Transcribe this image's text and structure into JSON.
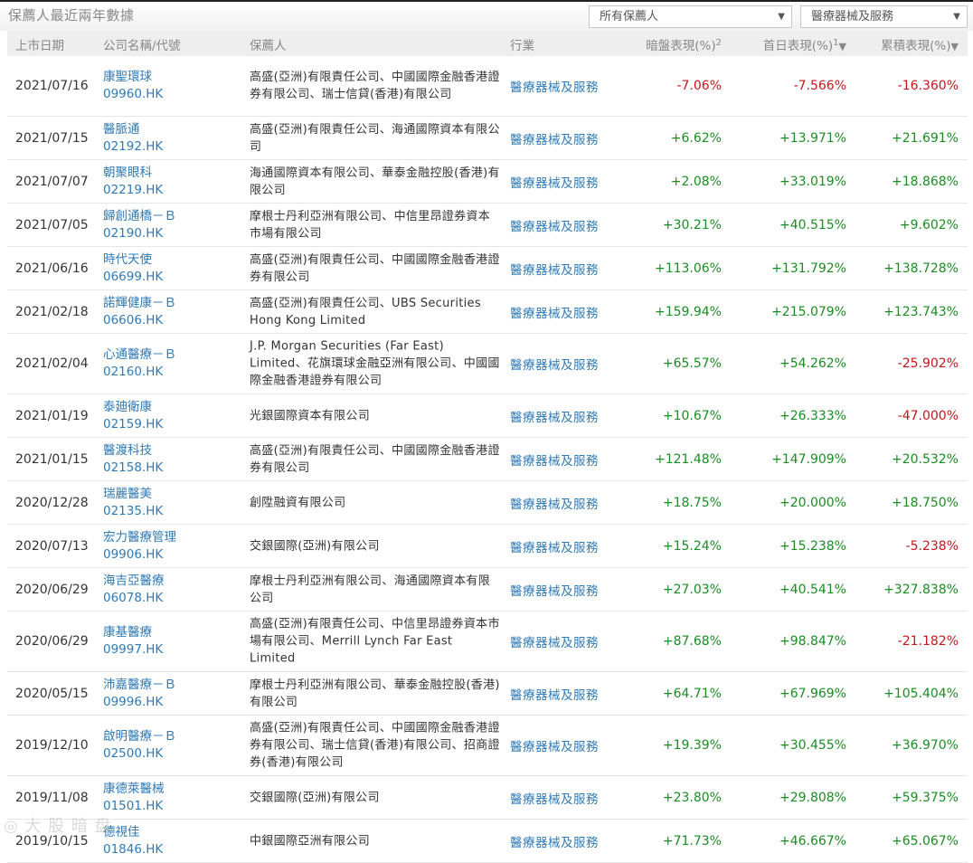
{
  "header": {
    "title": "保薦人最近兩年數據",
    "sponsor_filter": "所有保薦人",
    "industry_filter": "醫療器械及服務"
  },
  "columns": {
    "date": "上市日期",
    "company": "公司名稱/代號",
    "sponsor": "保薦人",
    "industry": "行業",
    "grey": "暗盤表現(%)",
    "grey_sup": "2",
    "first": "首日表現(%)",
    "first_sup": "1",
    "first_sort": "▼",
    "cum": "累積表現(%)",
    "cum_sort": "▼"
  },
  "rows": [
    {
      "date": "2021/07/16",
      "name": "康聖環球",
      "code": "09960.HK",
      "sponsor": "高盛(亞洲)有限責任公司、中國國際金融香港證券有限公司、瑞士信貸(香港)有限公司",
      "industry": "醫療器械及服務",
      "grey": "-7.06%",
      "first": "-7.566%",
      "cum": "-16.360%"
    },
    {
      "date": "2021/07/15",
      "name": "醫脈通",
      "code": "02192.HK",
      "sponsor": "高盛(亞洲)有限責任公司、海通國際資本有限公司",
      "industry": "醫療器械及服務",
      "grey": "+6.62%",
      "first": "+13.971%",
      "cum": "+21.691%"
    },
    {
      "date": "2021/07/07",
      "name": "朝聚眼科",
      "code": "02219.HK",
      "sponsor": "海通國際資本有限公司、華泰金融控股(香港)有限公司",
      "industry": "醫療器械及服務",
      "grey": "+2.08%",
      "first": "+33.019%",
      "cum": "+18.868%"
    },
    {
      "date": "2021/07/05",
      "name": "歸創通橋－Ｂ",
      "code": "02190.HK",
      "sponsor": "摩根士丹利亞洲有限公司、中信里昂證券資本市場有限公司",
      "industry": "醫療器械及服務",
      "grey": "+30.21%",
      "first": "+40.515%",
      "cum": "+9.602%"
    },
    {
      "date": "2021/06/16",
      "name": "時代天使",
      "code": "06699.HK",
      "sponsor": "高盛(亞洲)有限責任公司、中國國際金融香港證券有限公司",
      "industry": "醫療器械及服務",
      "grey": "+113.06%",
      "first": "+131.792%",
      "cum": "+138.728%"
    },
    {
      "date": "2021/02/18",
      "name": "諾輝健康－Ｂ",
      "code": "06606.HK",
      "sponsor": "高盛(亞洲)有限責任公司、UBS Securities Hong Kong Limited",
      "industry": "醫療器械及服務",
      "grey": "+159.94%",
      "first": "+215.079%",
      "cum": "+123.743%"
    },
    {
      "date": "2021/02/04",
      "name": "心通醫療－Ｂ",
      "code": "02160.HK",
      "sponsor": "J.P. Morgan Securities (Far East) Limited、花旗環球金融亞洲有限公司、中國國際金融香港證券有限公司",
      "industry": "醫療器械及服務",
      "grey": "+65.57%",
      "first": "+54.262%",
      "cum": "-25.902%"
    },
    {
      "date": "2021/01/19",
      "name": "泰廸衛康",
      "code": "02159.HK",
      "sponsor": "光銀國際資本有限公司",
      "industry": "醫療器械及服務",
      "grey": "+10.67%",
      "first": "+26.333%",
      "cum": "-47.000%"
    },
    {
      "date": "2021/01/15",
      "name": "醫渡科技",
      "code": "02158.HK",
      "sponsor": "高盛(亞洲)有限責任公司、中國國際金融香港證券有限公司",
      "industry": "醫療器械及服務",
      "grey": "+121.48%",
      "first": "+147.909%",
      "cum": "+20.532%"
    },
    {
      "date": "2020/12/28",
      "name": "瑞麗醫美",
      "code": "02135.HK",
      "sponsor": "創陞融資有限公司",
      "industry": "醫療器械及服務",
      "grey": "+18.75%",
      "first": "+20.000%",
      "cum": "+18.750%"
    },
    {
      "date": "2020/07/13",
      "name": "宏力醫療管理",
      "code": "09906.HK",
      "sponsor": "交銀國際(亞洲)有限公司",
      "industry": "醫療器械及服務",
      "grey": "+15.24%",
      "first": "+15.238%",
      "cum": "-5.238%"
    },
    {
      "date": "2020/06/29",
      "name": "海吉亞醫療",
      "code": "06078.HK",
      "sponsor": "摩根士丹利亞洲有限公司、海通國際資本有限公司",
      "industry": "醫療器械及服務",
      "grey": "+27.03%",
      "first": "+40.541%",
      "cum": "+327.838%"
    },
    {
      "date": "2020/06/29",
      "name": "康基醫療",
      "code": "09997.HK",
      "sponsor": "高盛(亞洲)有限責任公司、中信里昂證券資本市場有限公司、Merrill Lynch Far East Limited",
      "industry": "醫療器械及服務",
      "grey": "+87.68%",
      "first": "+98.847%",
      "cum": "-21.182%"
    },
    {
      "date": "2020/05/15",
      "name": "沛嘉醫療－Ｂ",
      "code": "09996.HK",
      "sponsor": "摩根士丹利亞洲有限公司、華泰金融控股(香港)有限公司",
      "industry": "醫療器械及服務",
      "grey": "+64.71%",
      "first": "+67.969%",
      "cum": "+105.404%"
    },
    {
      "date": "2019/12/10",
      "name": "啟明醫療－Ｂ",
      "code": "02500.HK",
      "sponsor": "高盛(亞洲)有限責任公司、中國國際金融香港證券有限公司、瑞士信貸(香港)有限公司、招商證券(香港)有限公司",
      "industry": "醫療器械及服務",
      "grey": "+19.39%",
      "first": "+30.455%",
      "cum": "+36.970%"
    },
    {
      "date": "2019/11/08",
      "name": "康德萊醫械",
      "code": "01501.HK",
      "sponsor": "交銀國際(亞洲)有限公司",
      "industry": "醫療器械及服務",
      "grey": "+23.80%",
      "first": "+29.808%",
      "cum": "+59.375%"
    },
    {
      "date": "2019/10/15",
      "name": "德視佳",
      "code": "01846.HK",
      "sponsor": "中銀國際亞洲有限公司",
      "industry": "醫療器械及服務",
      "grey": "+71.73%",
      "first": "+46.667%",
      "cum": "+65.067%"
    }
  ],
  "colors": {
    "up": "#1a8c23",
    "down": "#c4161c",
    "link": "#2f7ab5"
  }
}
